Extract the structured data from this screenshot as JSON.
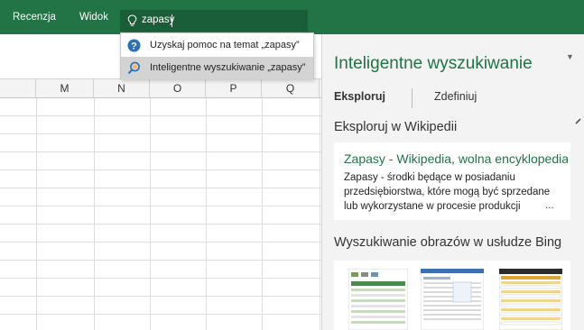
{
  "ribbon": {
    "tabs": [
      "Recenzja",
      "Widok"
    ],
    "tell_me_value": "zapasy",
    "tell_me_icon": "lightbulb-icon"
  },
  "columns": [
    "M",
    "N",
    "O",
    "P",
    "Q"
  ],
  "dropdown": {
    "items": [
      {
        "label": "Uzyskaj pomoc na temat „zapasy”",
        "icon": "help-icon"
      },
      {
        "label": "Inteligentne wyszukiwanie „zapasy”",
        "icon": "smart-lookup-icon"
      }
    ]
  },
  "pane": {
    "title": "Inteligentne wyszukiwanie",
    "menu_glyph": "▼",
    "tabs": {
      "explore": "Eksploruj",
      "define": "Zdefiniuj"
    },
    "wiki_section": "Eksploruj w Wikipedii",
    "result": {
      "title": "Zapasy - Wikipedia, wolna encyklopedia",
      "lines": [
        "Zapasy - środki będące w posiadaniu",
        "przedsiębiorstwa, które mogą być sprzedane",
        "lub wykorzystane w procesie produkcji"
      ],
      "ellipsis": "..."
    },
    "images_section": "Wyszukiwanie obrazów w usłudze Bing"
  },
  "colors": {
    "ribbon_green": "#227447",
    "accent_green": "#217346",
    "help_blue": "#2b6fb6"
  }
}
